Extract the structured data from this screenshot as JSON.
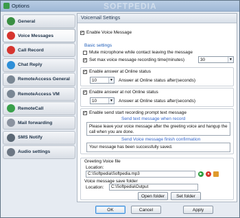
{
  "window": {
    "title": "Options",
    "watermark": "SOFTPEDIA"
  },
  "sidebar": {
    "items": [
      {
        "label": "General",
        "icon": "pine-icon",
        "color": "#3a8f43"
      },
      {
        "label": "Voice Messages",
        "icon": "voice-icon",
        "color": "#d6352f"
      },
      {
        "label": "Call Record",
        "icon": "record-icon",
        "color": "#d6352f"
      },
      {
        "label": "Chat Reply",
        "icon": "chat-icon",
        "color": "#2e8fd8"
      },
      {
        "label": "RemoteAccess General",
        "icon": "remote-icon",
        "color": "#7a8794"
      },
      {
        "label": "RemoteAccess VM",
        "icon": "remote-vm-icon",
        "color": "#7a8794"
      },
      {
        "label": "RemoteCall",
        "icon": "remote-call-icon",
        "color": "#3aa04b"
      },
      {
        "label": "Mail forwarding",
        "icon": "mail-icon",
        "color": "#8b93a0"
      },
      {
        "label": "SMS Notify",
        "icon": "sms-icon",
        "color": "#5b6875"
      },
      {
        "label": "Audio settings",
        "icon": "audio-icon",
        "color": "#6d7784"
      }
    ],
    "active_index": 1
  },
  "content": {
    "header": "Voicemail Settings",
    "enable_voice_message": "Enable Voice Message",
    "basic_settings": "Basic settings",
    "mute_mic": "Mute microphone while contact leaving the message",
    "set_max": "Set max voice message recording time(minutes)",
    "max_value": "30",
    "enable_online": "Enable answer at Online status",
    "online_after": "Answer at Online status after(seconds)",
    "online_value": "10",
    "enable_not_online": "Enable answer at not Online status",
    "not_online_after": "Answer at Online status  after(seconds)",
    "not_online_value": "10",
    "enable_prompt": "Enable send start recording prompt text message",
    "send_text_title": "Send text message when record",
    "send_text_body": "Please leave your voice message after the greeting voice and hangup the call when you are done.",
    "finish_title": "Send Voice message finish confirmation",
    "finish_body": "Your message has been successfully saved.",
    "greeting_title": "Greeting Voice file",
    "location_label": "Location:",
    "greeting_path": "C:\\Softpedia\\Softpedia.mp3",
    "save_title": "Voice message save folder",
    "save_location_label": "Location:",
    "save_path": "C:\\Softpedia\\Output",
    "open_folder": "Open folder",
    "set_folder": "Set folder"
  },
  "footer": {
    "ok": "OK",
    "cancel": "Cancel",
    "apply": "Apply"
  }
}
